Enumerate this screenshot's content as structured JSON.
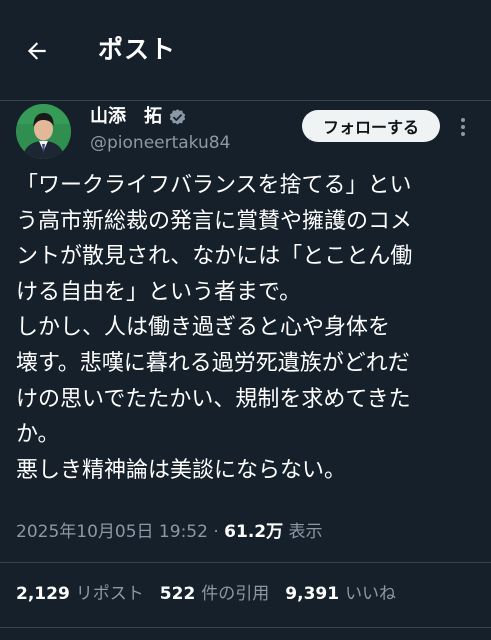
{
  "header": {
    "back_icon": "arrow-left-icon",
    "title": "ポスト"
  },
  "author": {
    "name": "山添　拓",
    "handle": "@pioneertaku84",
    "verified_icon": "verified-badge-icon",
    "verified_color": "#8b98a5",
    "avatar_bg": "#2f8f4e"
  },
  "actions": {
    "follow_label": "フォローする",
    "more_icon": "more-vertical-icon"
  },
  "post": {
    "lines": [
      "「ワークライフバランスを捨てる」とい",
      "う高市新総裁の発言に賞賛や擁護のコメ",
      "ントが散見され、なかには「とことん働",
      "ける自由を」という者まで。",
      "しかし、人は働き過ぎると心や身体を",
      "壊す。悲嘆に暮れる過労死遺族がどれだ",
      "けの思いでたたかい、規制を求めてきた",
      "か。",
      "悪しき精神論は美談にならない。"
    ]
  },
  "meta": {
    "datetime": "2025年10月05日 19:52",
    "separator": " · ",
    "views_count": "61.2万",
    "views_label": " 表示"
  },
  "stats": {
    "reposts_count": "2,129",
    "reposts_label": "リポスト",
    "quotes_count": "522",
    "quotes_label": "件の引用",
    "likes_count": "9,391",
    "likes_label": "いいね"
  },
  "colors": {
    "background": "#15202b",
    "text_primary": "#ffffff",
    "text_secondary": "#8b98a5",
    "divider": "#38444d",
    "follow_bg": "#eff3f4"
  }
}
